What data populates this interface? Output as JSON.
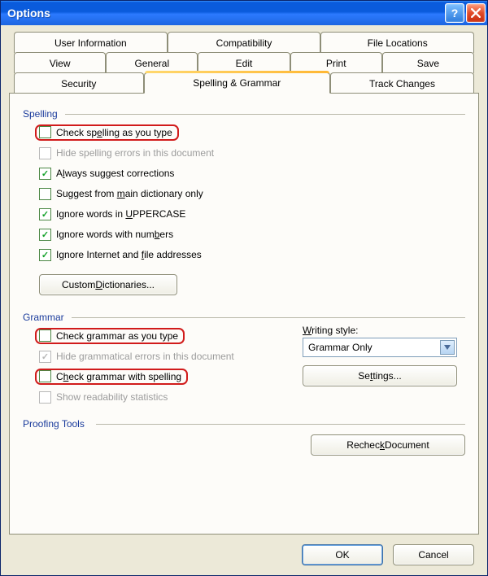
{
  "window": {
    "title": "Options"
  },
  "tabs": {
    "row1": [
      "User Information",
      "Compatibility",
      "File Locations"
    ],
    "row2": [
      "View",
      "General",
      "Edit",
      "Print",
      "Save"
    ],
    "row3": [
      "Security",
      "Spelling & Grammar",
      "Track Changes"
    ]
  },
  "spelling": {
    "title": "Spelling",
    "items": {
      "check_as_type": "Check spelling as you type",
      "hide_errors": "Hide spelling errors in this document",
      "always_suggest": "Always suggest corrections",
      "main_dict_only": "Suggest from main dictionary only",
      "ignore_upper": "Ignore words in UPPERCASE",
      "ignore_numbers": "Ignore words with numbers",
      "ignore_internet": "Ignore Internet and file addresses"
    },
    "custom_dict_btn": "Custom Dictionaries..."
  },
  "grammar": {
    "title": "Grammar",
    "items": {
      "check_as_type": "Check grammar as you type",
      "hide_errors": "Hide grammatical errors in this document",
      "with_spelling": "Check grammar with spelling",
      "readability": "Show readability statistics"
    },
    "writing_style_label": "Writing style:",
    "writing_style_value": "Grammar Only",
    "settings_btn": "Settings..."
  },
  "proofing": {
    "title": "Proofing Tools",
    "recheck_btn": "Recheck Document"
  },
  "buttons": {
    "ok": "OK",
    "cancel": "Cancel"
  }
}
